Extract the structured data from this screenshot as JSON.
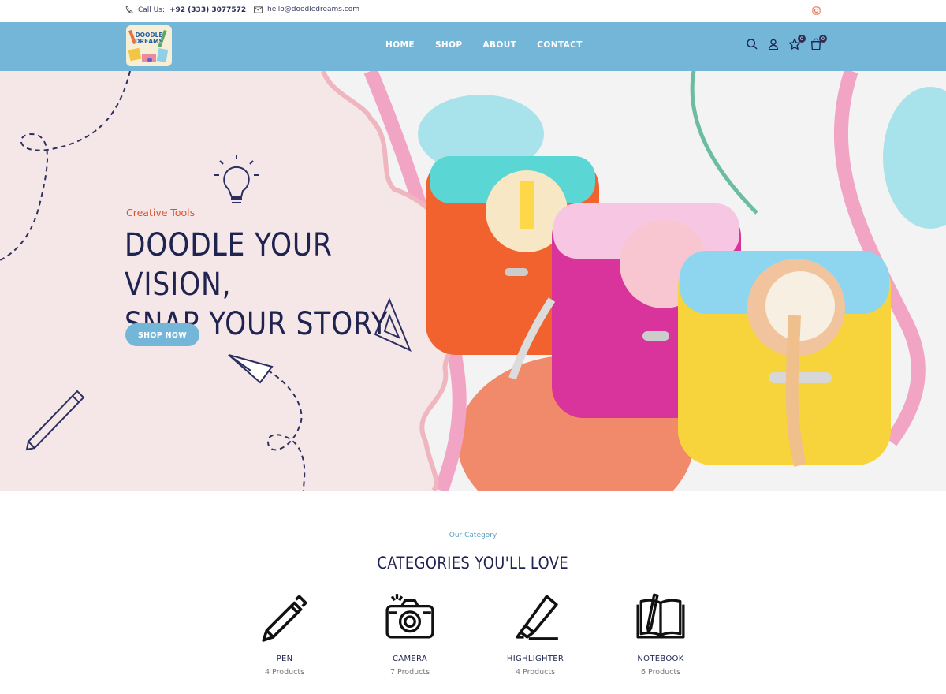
{
  "topbar": {
    "call_label": "Call Us:",
    "phone": "+92 (333) 3077572",
    "email": "hello@doodledreams.com"
  },
  "header": {
    "logo_text": "DOODLE DREAMS",
    "nav": [
      "HOME",
      "SHOP",
      "ABOUT",
      "CONTACT"
    ],
    "wishlist_count": "0",
    "cart_count": "0"
  },
  "hero": {
    "tagline": "Creative Tools",
    "headline_line1": "DOODLE YOUR VISION,",
    "headline_line2": "SNAP YOUR STORY",
    "cta": "SHOP NOW"
  },
  "categories": {
    "subtitle": "Our Category",
    "title": "CATEGORIES YOU'LL LOVE",
    "items": [
      {
        "name": "PEN",
        "count": "4 Products",
        "icon": "pen-icon"
      },
      {
        "name": "CAMERA",
        "count": "7 Products",
        "icon": "camera-icon"
      },
      {
        "name": "HIGHLIGHTER",
        "count": "4 Products",
        "icon": "highlighter-icon"
      },
      {
        "name": "NOTEBOOK",
        "count": "6 Products",
        "icon": "notebook-icon"
      }
    ]
  },
  "colors": {
    "header_bg": "#73b6d7",
    "accent_orange": "#e0532c",
    "navy": "#1f2350",
    "hero_pink": "#f5e6e7"
  }
}
